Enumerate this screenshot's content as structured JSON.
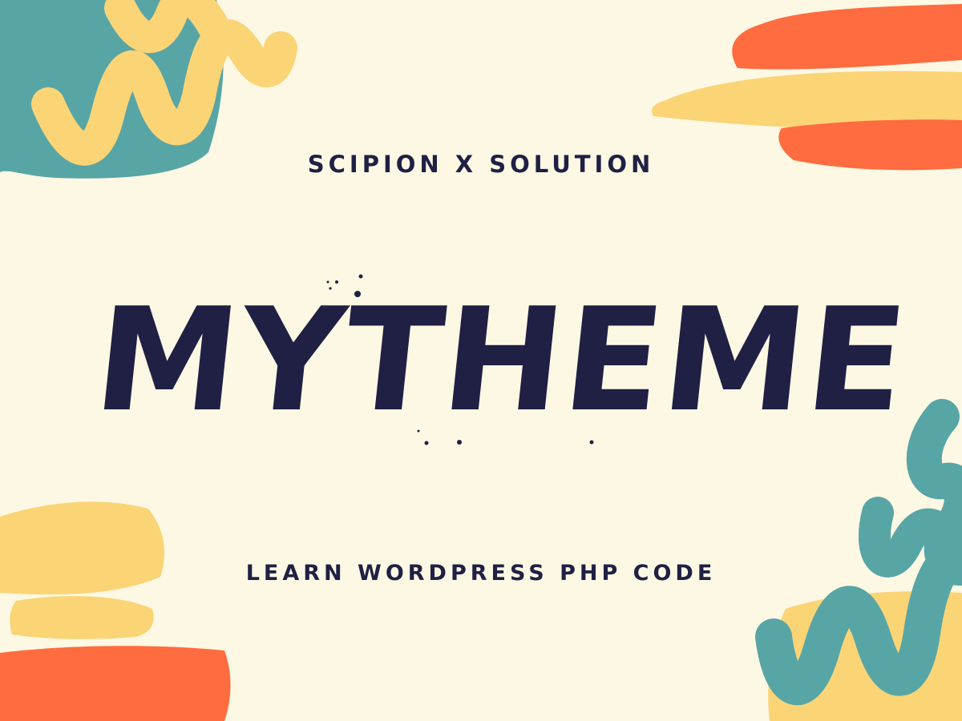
{
  "brand": {
    "subtitle": "SCIPION X SOLUTION",
    "title": "MYTHEME",
    "tagline": "LEARN WORDPRESS PHP CODE"
  },
  "colors": {
    "background": "#fdf8e3",
    "text": "#1f2044",
    "teal": "#58a5a6",
    "yellow": "#fbd476",
    "orange": "#fe6c40"
  }
}
